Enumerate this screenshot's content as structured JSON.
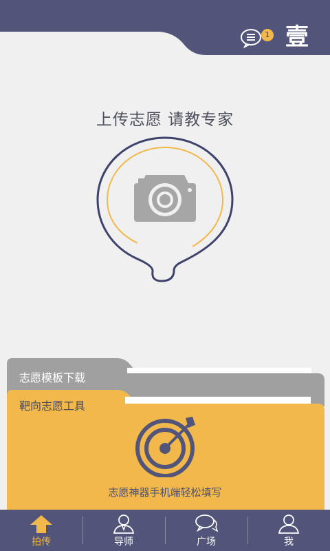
{
  "header": {
    "message_icon": "message-list-icon",
    "unread_count": "1",
    "logo_text": "壹",
    "accent_color": "#f2b84b",
    "bar_color": "#525579"
  },
  "main": {
    "headline": "上传志愿  请教专家",
    "camera_icon": "camera-icon"
  },
  "folders": [
    {
      "label": "志愿模板下载",
      "color": "#a0a0a0"
    },
    {
      "label": "靶向志愿工具",
      "color": "#f2b84b",
      "caption": "志愿神器手机端轻松填写",
      "icon": "target-icon"
    }
  ],
  "nav": {
    "items": [
      {
        "label": "拍传",
        "icon": "upload-arrow-icon",
        "active": true
      },
      {
        "label": "导师",
        "icon": "person-icon",
        "active": false
      },
      {
        "label": "广场",
        "icon": "chat-icon",
        "active": false
      },
      {
        "label": "我",
        "icon": "user-icon",
        "active": false
      }
    ]
  }
}
